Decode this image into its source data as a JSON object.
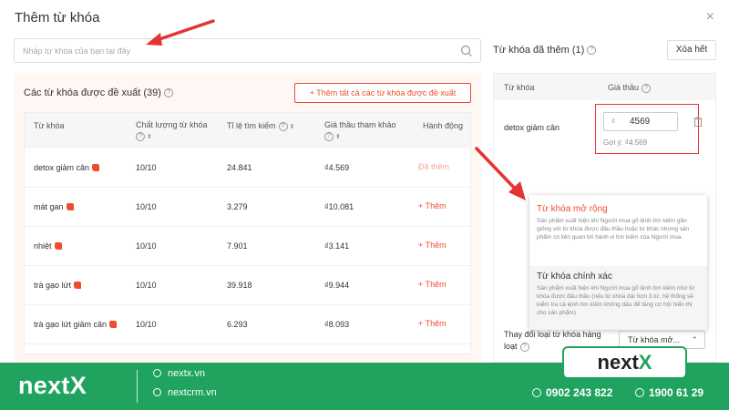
{
  "modal": {
    "title": "Thêm từ khóa",
    "close_icon": "×"
  },
  "search": {
    "placeholder": "Nhập từ khóa của bạn tại đây"
  },
  "suggested": {
    "title": "Các từ khóa được đề xuất (39)",
    "add_all_label": "+ Thêm tất cả các từ khóa được đề xuất",
    "columns": {
      "keyword": "Từ khóa",
      "quality": "Chất lượng từ khóa",
      "search_rate": "Tỉ lệ tìm kiếm",
      "bid": "Giá thầu tham khảo",
      "action": "Hành động"
    },
    "rows": [
      {
        "keyword": "detox giảm cân",
        "quality": "10/10",
        "rate": "24.841",
        "bid": "₫4.569",
        "action": "Đã thêm"
      },
      {
        "keyword": "mát gan",
        "quality": "10/10",
        "rate": "3.279",
        "bid": "₫10.081",
        "action": "+ Thêm"
      },
      {
        "keyword": "nhiệt",
        "quality": "10/10",
        "rate": "7.901",
        "bid": "₫3.141",
        "action": "+ Thêm"
      },
      {
        "keyword": "trà gạo lứt",
        "quality": "10/10",
        "rate": "39.918",
        "bid": "₫9.944",
        "action": "+ Thêm"
      },
      {
        "keyword": "trà gạo lứt giảm cân",
        "quality": "10/10",
        "rate": "6.293",
        "bid": "₫8.093",
        "action": "+ Thêm"
      }
    ]
  },
  "added": {
    "title": "Từ khóa đã thêm (1)",
    "clear_label": "Xóa hết",
    "col_keyword": "Từ khóa",
    "col_bid": "Giá thầu",
    "keyword": "detox giảm cân",
    "currency": "₫",
    "bid_value": "4569",
    "suggestion": "Gợi ý: ₫4.569"
  },
  "match_type": {
    "broad_title": "Từ khóa mở rộng",
    "broad_desc": "Sản phẩm xuất hiện khi Người mua gõ lệnh tìm kiếm gần giống với từ khóa được đấu thầu hoặc từ khác nhưng sản phẩm có liên quan tới hành vi tìm kiếm của Người mua.",
    "exact_title": "Từ khóa chính xác",
    "exact_desc": "Sản phẩm xuất hiện khi Người mua gõ lệnh tìm kiếm như từ khóa được đấu thầu (nếu từ khóa dài hơn 3 từ, hệ thống sẽ kiểm tra cả lệnh tìm kiếm không dấu để tăng cơ hội hiển thị cho sản phẩm)",
    "change_label": "Thay đổi loại từ khóa hàng loạt",
    "selected": "Từ khóa mở..."
  },
  "footer": {
    "brand": "nextX",
    "logo_main": "next",
    "logo_x": "X",
    "link1": "nextx.vn",
    "link2": "nextcrm.vn",
    "phone1": "0902 243 822",
    "phone2": "1900 61 29"
  },
  "colors": {
    "accent": "#ee4d2d",
    "brand_green": "#1fa35e",
    "annotation_red": "#e33333"
  }
}
